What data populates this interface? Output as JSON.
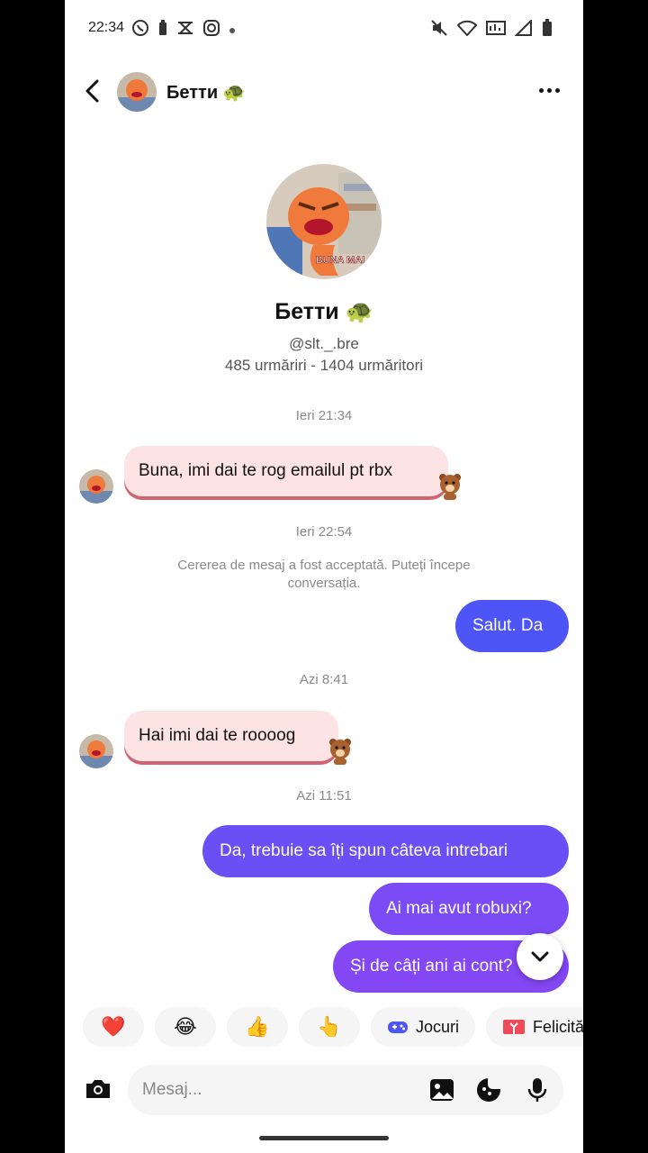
{
  "status_bar": {
    "time": "22:34"
  },
  "header": {
    "name": "Бетти 🐢"
  },
  "profile": {
    "name": "Бетти 🐢",
    "handle": "@slt._.bre",
    "stats": "485 urmăriri - 1404 urmăritori",
    "avatar_caption": "BUNA MAI"
  },
  "chat": {
    "ts1": "Ieri 21:34",
    "msg1": "Buna, imi dai te rog emailul pt rbx",
    "ts2": "Ieri 22:54",
    "system": "Cererea de mesaj a fost acceptată. Puteți începe conversația.",
    "msg2": "Salut. Da",
    "ts3": "Azi 8:41",
    "msg3": "Hai imi dai te roooog",
    "ts4": "Azi 11:51",
    "msg4": "Da, trebuie sa îți spun câteva intrebari",
    "msg5": "Ai mai avut robuxi?",
    "msg6": "Și de câți ani ai cont?"
  },
  "quick_replies": [
    "❤️",
    "😂",
    "👍",
    "👆",
    "Jocuri",
    "Felicită"
  ],
  "input": {
    "placeholder": "Mesaj..."
  },
  "colors": {
    "incoming": "#fde3e4",
    "outgoing_blue": "#4d55f6",
    "outgoing_purple": "#7b4bf5"
  }
}
